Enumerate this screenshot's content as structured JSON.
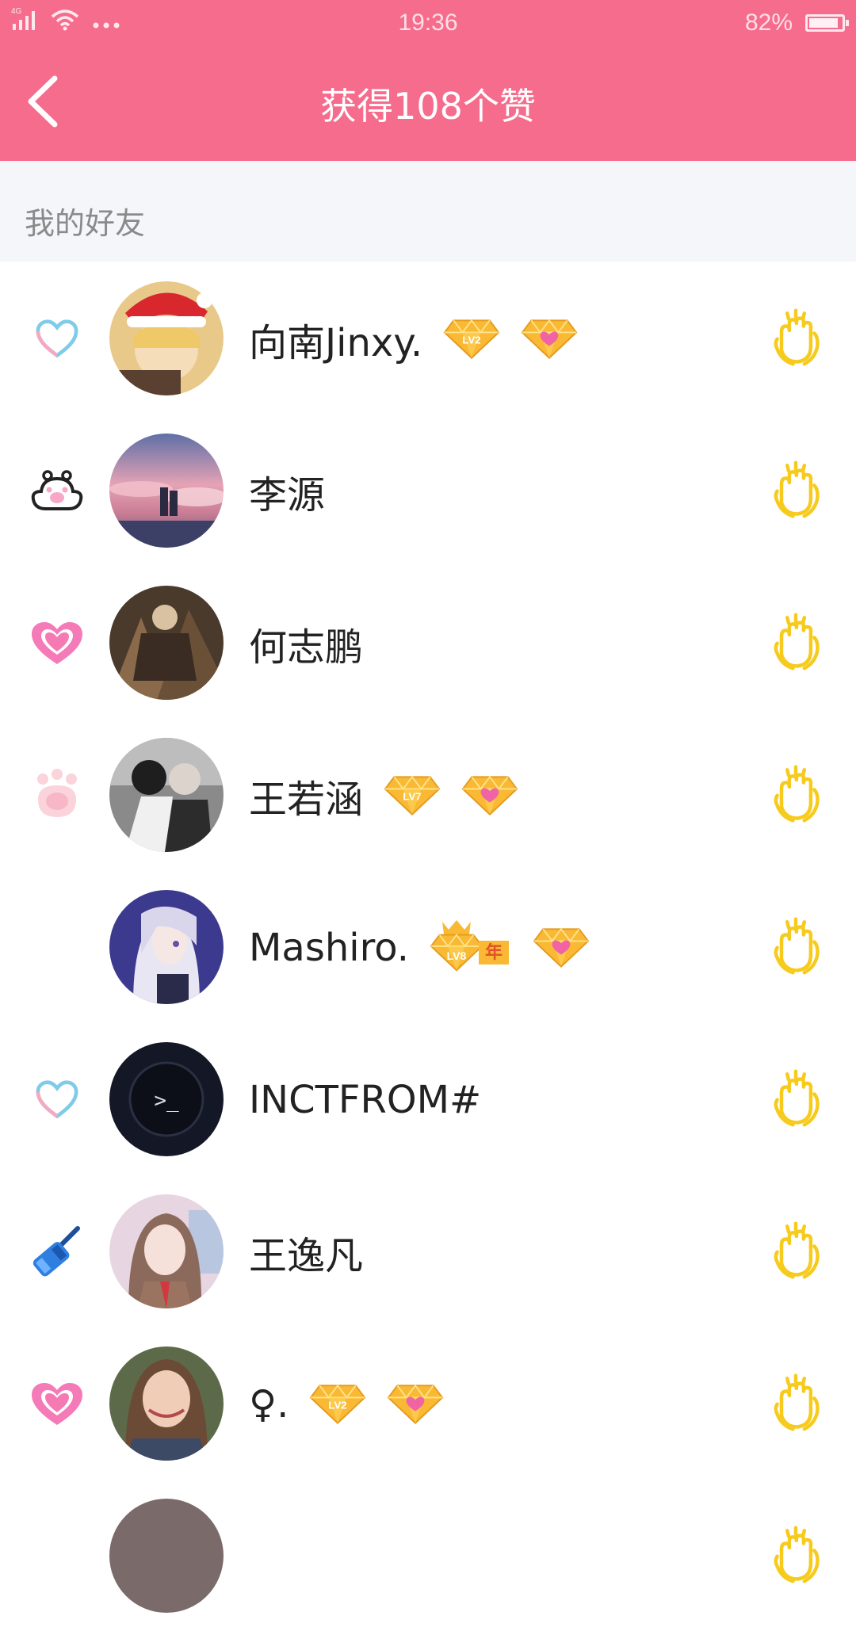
{
  "status_bar": {
    "network": "4G",
    "time": "19:36",
    "battery_percent": "82%",
    "battery_level": 0.82
  },
  "nav": {
    "title": "获得108个赞"
  },
  "section": {
    "title": "我的好友"
  },
  "friends": [
    {
      "name": "向南Jinxy.",
      "left_badge": "heart-outline-icon",
      "level_badge": "LV2",
      "has_vip_badge": true
    },
    {
      "name": "李源",
      "left_badge": "paw-outline-icon",
      "level_badge": "",
      "has_vip_badge": false
    },
    {
      "name": "何志鹏",
      "left_badge": "heart-pink-icon",
      "level_badge": "",
      "has_vip_badge": false
    },
    {
      "name": "王若涵",
      "left_badge": "paw-pink-icon",
      "level_badge": "LV7",
      "has_vip_badge": true
    },
    {
      "name": "Mashiro.",
      "left_badge": "",
      "level_badge": "LV8",
      "year_badge": "年",
      "has_vip_badge": true
    },
    {
      "name": "INCTFROM#",
      "left_badge": "heart-outline-icon",
      "level_badge": "",
      "has_vip_badge": false
    },
    {
      "name": "王逸凡",
      "left_badge": "hammer-icon",
      "level_badge": "",
      "has_vip_badge": false
    },
    {
      "name": "♀.",
      "left_badge": "heart-pink-icon",
      "level_badge": "LV2",
      "has_vip_badge": true
    }
  ],
  "colors": {
    "header": "#F66C8D",
    "section_bg": "#F5F6FA",
    "clap": "#F7CB1E"
  }
}
